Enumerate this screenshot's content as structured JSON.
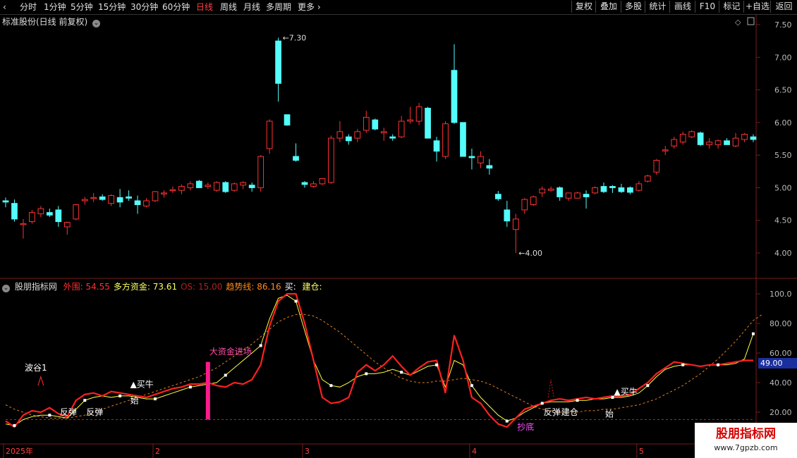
{
  "toolbar": {
    "periods": [
      "分时",
      "1分钟",
      "5分钟",
      "15分钟",
      "30分钟",
      "60分钟",
      "日线",
      "周线",
      "月线",
      "多周期",
      "更多"
    ],
    "active_period": "日线",
    "right_buttons": [
      "复权",
      "叠加",
      "多股",
      "统计",
      "画线",
      "F10",
      "标记",
      "+自选",
      "返回"
    ]
  },
  "main_panel": {
    "title": "标准股份(日线 前复权)",
    "high_label": "7.30",
    "low_label": "4.00",
    "y_ticks": [
      "7.50",
      "7.00",
      "6.50",
      "6.00",
      "5.50",
      "5.00",
      "4.50",
      "4.00"
    ]
  },
  "indicator_panel": {
    "name": "股朋指标网",
    "items": [
      {
        "label": "外围:",
        "value": "54.55",
        "color": "#ff3030"
      },
      {
        "label": "多方资金:",
        "value": "73.61",
        "color": "#ffff60"
      },
      {
        "label": "OS:",
        "value": "15.00",
        "color": "#b02020"
      },
      {
        "label": "趋势线:",
        "value": "86.16",
        "color": "#ff8c1a"
      },
      {
        "label": "买:",
        "value": "",
        "color": "#ffffff"
      },
      {
        "label": "建仓:",
        "value": "",
        "color": "#ffff60"
      }
    ],
    "y_ticks": [
      "100.0",
      "80.00",
      "60.00",
      "40.00",
      "20.00"
    ],
    "current_value": "49.00",
    "annotations": [
      {
        "text": "波谷1",
        "color": "#ffffff"
      },
      {
        "text": "反弹",
        "color": "#ffffff"
      },
      {
        "text": "反弹",
        "color": "#ffffff"
      },
      {
        "text": "▲买牛",
        "color": "#ffffff"
      },
      {
        "text": "始",
        "color": "#ffffff"
      },
      {
        "text": "大资金进场",
        "color": "#ff4da6"
      },
      {
        "text": "抄底",
        "color": "#ff4dff"
      },
      {
        "text": "反弹",
        "color": "#ffffff"
      },
      {
        "text": "建仓",
        "color": "#ffffff"
      },
      {
        "text": "▲买牛",
        "color": "#ffffff"
      },
      {
        "text": "始",
        "color": "#ffffff"
      }
    ]
  },
  "x_axis": {
    "labels": [
      "2025年",
      "2",
      "3",
      "4",
      "5"
    ]
  },
  "watermark": {
    "line1": "股朋指标网",
    "line2": "www.7gpzb.com"
  },
  "colors": {
    "up": "#ff3232",
    "down": "#54fcfc",
    "grid": "#7a1a1a"
  },
  "chart_data": {
    "type": "candlestick",
    "ohlc": [
      [
        4.8,
        4.85,
        4.7,
        4.78
      ],
      [
        4.76,
        4.82,
        4.48,
        4.52
      ],
      [
        4.45,
        4.52,
        4.22,
        4.45
      ],
      [
        4.48,
        4.66,
        4.45,
        4.62
      ],
      [
        4.6,
        4.72,
        4.55,
        4.68
      ],
      [
        4.62,
        4.68,
        4.55,
        4.58
      ],
      [
        4.66,
        4.72,
        4.4,
        4.48
      ],
      [
        4.4,
        4.48,
        4.28,
        4.47
      ],
      [
        4.52,
        4.75,
        4.5,
        4.74
      ],
      [
        4.8,
        4.86,
        4.74,
        4.82
      ],
      [
        4.84,
        4.92,
        4.78,
        4.85
      ],
      [
        4.86,
        4.9,
        4.8,
        4.82
      ],
      [
        4.76,
        4.9,
        4.72,
        4.88
      ],
      [
        4.85,
        4.98,
        4.7,
        4.78
      ],
      [
        4.86,
        4.96,
        4.8,
        4.84
      ],
      [
        4.8,
        4.88,
        4.6,
        4.74
      ],
      [
        4.72,
        4.84,
        4.7,
        4.8
      ],
      [
        4.8,
        4.95,
        4.78,
        4.94
      ],
      [
        4.92,
        4.96,
        4.85,
        4.92
      ],
      [
        4.96,
        5.02,
        4.92,
        4.97
      ],
      [
        4.96,
        5.05,
        4.9,
        5.02
      ],
      [
        5.0,
        5.1,
        4.96,
        5.06
      ],
      [
        5.1,
        5.12,
        5.0,
        5.0
      ],
      [
        5.02,
        5.08,
        4.98,
        5.04
      ],
      [
        4.96,
        5.1,
        4.94,
        5.08
      ],
      [
        5.08,
        5.1,
        4.92,
        4.94
      ],
      [
        4.96,
        5.08,
        4.94,
        5.06
      ],
      [
        5.04,
        5.1,
        4.98,
        5.08
      ],
      [
        5.04,
        5.08,
        4.94,
        5.0
      ],
      [
        5.0,
        5.5,
        4.94,
        5.48
      ],
      [
        5.6,
        6.05,
        5.52,
        6.02
      ],
      [
        7.25,
        7.3,
        6.32,
        6.6
      ],
      [
        6.12,
        6.12,
        5.95,
        5.96
      ],
      [
        5.48,
        5.68,
        5.4,
        5.42
      ],
      [
        5.08,
        5.1,
        5.0,
        5.05
      ],
      [
        5.02,
        5.1,
        5.0,
        5.06
      ],
      [
        5.06,
        5.14,
        5.04,
        5.14
      ],
      [
        5.08,
        5.8,
        5.06,
        5.76
      ],
      [
        5.76,
        6.02,
        5.7,
        5.86
      ],
      [
        5.78,
        5.82,
        5.66,
        5.72
      ],
      [
        5.76,
        5.9,
        5.7,
        5.86
      ],
      [
        5.88,
        6.18,
        5.84,
        6.08
      ],
      [
        6.04,
        6.06,
        5.88,
        5.9
      ],
      [
        5.84,
        5.92,
        5.72,
        5.86
      ],
      [
        5.78,
        5.82,
        5.72,
        5.76
      ],
      [
        5.78,
        6.1,
        5.76,
        6.02
      ],
      [
        6.02,
        6.24,
        5.98,
        6.04
      ],
      [
        6.02,
        6.3,
        5.96,
        6.24
      ],
      [
        6.22,
        6.24,
        5.76,
        5.76
      ],
      [
        5.72,
        5.78,
        5.4,
        5.56
      ],
      [
        5.48,
        6.02,
        5.44,
        5.98
      ],
      [
        6.8,
        7.2,
        5.98,
        6.0
      ],
      [
        6.0,
        6.0,
        5.48,
        5.48
      ],
      [
        5.48,
        5.6,
        5.28,
        5.46
      ],
      [
        5.38,
        5.56,
        5.3,
        5.48
      ],
      [
        5.34,
        5.44,
        5.2,
        5.3
      ],
      [
        4.9,
        4.95,
        4.8,
        4.83
      ],
      [
        4.66,
        4.8,
        4.4,
        4.49
      ],
      [
        4.36,
        4.6,
        4.0,
        4.52
      ],
      [
        4.66,
        4.84,
        4.6,
        4.82
      ],
      [
        4.74,
        4.88,
        4.72,
        4.86
      ],
      [
        4.92,
        5.02,
        4.86,
        4.98
      ],
      [
        4.96,
        5.02,
        4.94,
        4.98
      ],
      [
        5.0,
        5.02,
        4.8,
        4.86
      ],
      [
        4.84,
        4.92,
        4.8,
        4.92
      ],
      [
        4.84,
        4.94,
        4.84,
        4.92
      ],
      [
        4.9,
        4.96,
        4.68,
        4.86
      ],
      [
        4.92,
        5.02,
        4.9,
        5.0
      ],
      [
        5.02,
        5.08,
        4.92,
        4.94
      ],
      [
        5.02,
        5.04,
        4.92,
        5.0
      ],
      [
        5.0,
        5.06,
        4.92,
        4.94
      ],
      [
        5.0,
        5.02,
        4.9,
        4.93
      ],
      [
        4.96,
        5.1,
        4.94,
        5.06
      ],
      [
        5.1,
        5.2,
        5.08,
        5.18
      ],
      [
        5.24,
        5.44,
        5.2,
        5.42
      ],
      [
        5.58,
        5.64,
        5.5,
        5.58
      ],
      [
        5.64,
        5.78,
        5.6,
        5.74
      ],
      [
        5.7,
        5.86,
        5.66,
        5.82
      ],
      [
        5.78,
        5.88,
        5.76,
        5.86
      ],
      [
        5.84,
        5.86,
        5.64,
        5.66
      ],
      [
        5.66,
        5.76,
        5.6,
        5.7
      ],
      [
        5.66,
        5.74,
        5.6,
        5.72
      ],
      [
        5.72,
        5.76,
        5.66,
        5.66
      ],
      [
        5.64,
        5.84,
        5.62,
        5.76
      ],
      [
        5.74,
        5.84,
        5.7,
        5.82
      ],
      [
        5.78,
        5.82,
        5.7,
        5.74
      ]
    ],
    "ylim": [
      3.95,
      7.55
    ],
    "indicator_ylim": [
      12,
      105
    ],
    "series": [
      {
        "name": "外围",
        "color": "#ff2020",
        "values": [
          14,
          10,
          18,
          21,
          20,
          23,
          19,
          17,
          28,
          32,
          33,
          31,
          34,
          33,
          32,
          31,
          30,
          32,
          34,
          36,
          37,
          39,
          39,
          40,
          38,
          37,
          40,
          39,
          42,
          52,
          78,
          95,
          100,
          100,
          80,
          55,
          30,
          26,
          27,
          30,
          47,
          52,
          48,
          52,
          58,
          51,
          45,
          50,
          54,
          55,
          33,
          72,
          55,
          30,
          26,
          18,
          12,
          10,
          16,
          22,
          24,
          26,
          28,
          29,
          28,
          29,
          30,
          29,
          30,
          31,
          31,
          32,
          36,
          40,
          46,
          50,
          54,
          53,
          52,
          51,
          52,
          52,
          53,
          54,
          55,
          55
        ]
      },
      {
        "name": "多方资金",
        "color": "#ffff40",
        "values": [
          12,
          11,
          15,
          17,
          18,
          18,
          17,
          16,
          22,
          28,
          30,
          31,
          30,
          31,
          31,
          30,
          29,
          29,
          31,
          33,
          35,
          37,
          38,
          39,
          40,
          45,
          50,
          55,
          60,
          65,
          83,
          97,
          99,
          95,
          75,
          55,
          42,
          38,
          37,
          40,
          44,
          46,
          46,
          47,
          49,
          47,
          45,
          48,
          51,
          52,
          37,
          55,
          52,
          38,
          30,
          24,
          18,
          14,
          16,
          20,
          23,
          26,
          27,
          27,
          27,
          28,
          28,
          29,
          29,
          30,
          30,
          31,
          33,
          38,
          44,
          49,
          51,
          52,
          52,
          51,
          52,
          52,
          52,
          53,
          56,
          73
        ]
      },
      {
        "name": "趋势线",
        "color": "#e08020",
        "values": [
          25,
          22,
          20,
          18,
          17,
          16,
          16,
          16,
          17,
          18,
          20,
          22,
          24,
          26,
          28,
          30,
          32,
          34,
          36,
          38,
          40,
          42,
          44,
          47,
          50,
          54,
          58,
          62,
          66,
          71,
          76,
          81,
          84,
          86,
          86,
          85,
          82,
          78,
          74,
          69,
          64,
          59,
          54,
          50,
          46,
          43,
          41,
          40,
          40,
          41,
          41,
          42,
          43,
          42,
          41,
          39,
          36,
          33,
          30,
          27,
          24,
          22,
          21,
          20,
          20,
          20,
          21,
          21,
          22,
          22,
          23,
          24,
          25,
          27,
          29,
          32,
          35,
          38,
          42,
          46,
          51,
          56,
          62,
          68,
          75,
          82,
          86
        ]
      },
      {
        "name": "OS",
        "color": "#c02020",
        "values": [
          15,
          15,
          15,
          15,
          15,
          15,
          15,
          15,
          15,
          15,
          15,
          15,
          15,
          15,
          15,
          15,
          15,
          15,
          15,
          15,
          15,
          15,
          15,
          15,
          15,
          15,
          15,
          15,
          15,
          15,
          15,
          15,
          15,
          15,
          15,
          15,
          15,
          15,
          15,
          15,
          15,
          15,
          15,
          15,
          15,
          15,
          15,
          15,
          15,
          15,
          15,
          15,
          15,
          15,
          15,
          15,
          15,
          15,
          15,
          15,
          15,
          15,
          15,
          15,
          15,
          15,
          15,
          15,
          15,
          15,
          15,
          15,
          15,
          15,
          15,
          15,
          15,
          15,
          15,
          15,
          15,
          15,
          15,
          15,
          15,
          15
        ]
      }
    ],
    "bar_index": 23,
    "bar_range": [
      15,
      54
    ]
  }
}
